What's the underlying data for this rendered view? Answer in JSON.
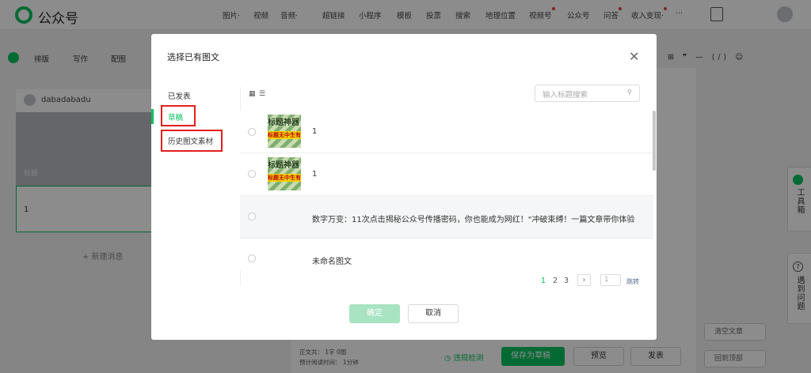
{
  "app": {
    "title": "公众号"
  },
  "topnav": [
    {
      "label": "图片·",
      "dot": false
    },
    {
      "label": "视频",
      "dot": false
    },
    {
      "label": "音频·",
      "dot": false
    },
    {
      "label": "超链接",
      "dot": false
    },
    {
      "label": "小程序",
      "dot": false
    },
    {
      "label": "模板",
      "dot": false
    },
    {
      "label": "投票",
      "dot": false
    },
    {
      "label": "搜索",
      "dot": false
    },
    {
      "label": "地理位置",
      "dot": false
    },
    {
      "label": "视频号",
      "dot": true
    },
    {
      "label": "公众号",
      "dot": false
    },
    {
      "label": "问答",
      "dot": true
    },
    {
      "label": "收入变现·",
      "dot": true
    },
    {
      "label": "···",
      "dot": false
    }
  ],
  "toolbar": {
    "layout": "排版",
    "write": "写作",
    "image": "配图",
    "right_icons": "⊞ ❞ — ⟨/⟩ ☺"
  },
  "left_panel": {
    "account": "dabadabadu",
    "cover_title": "标题",
    "item_number": "1",
    "new_message": "+ 新建消息"
  },
  "right_float": {
    "toolbox": "工具箱",
    "help": "遇到问题",
    "clear": "清空文章",
    "back_top": "回到顶部"
  },
  "bottom": {
    "word_count": "正文共： 1字 0图",
    "read_time": "预计阅读时间： 1分钟",
    "check": "违规检测",
    "save": "保存为草稿",
    "preview": "预览",
    "publish": "发表"
  },
  "modal": {
    "title": "选择已有图文",
    "close": "✕",
    "sidebar": [
      {
        "label": "已发表",
        "active": false
      },
      {
        "label": "草稿",
        "active": true
      },
      {
        "label": "历史图文素材",
        "active": false
      }
    ],
    "search_placeholder": "输入标题搜索",
    "rows": [
      {
        "title": "1",
        "has_thumb": true
      },
      {
        "title": "1",
        "has_thumb": true
      },
      {
        "title": "数字万变：11次点击揭秘公众号传播密码，你也能成为网红！\"冲破束缚！一篇文章带你体验",
        "has_thumb": false
      },
      {
        "title": "未命名图文",
        "has_thumb": false
      }
    ],
    "thumb_text": {
      "line1": "标题神器",
      "line2": "标题无中生有"
    },
    "pagination": {
      "pages": [
        "1",
        "2",
        "3"
      ],
      "current": "1",
      "next": "›",
      "page_input": "1",
      "jump": "跳转"
    },
    "ok": "确定",
    "cancel": "取消"
  },
  "colors": {
    "accent": "#07c160",
    "highlight": "#e0201b"
  }
}
